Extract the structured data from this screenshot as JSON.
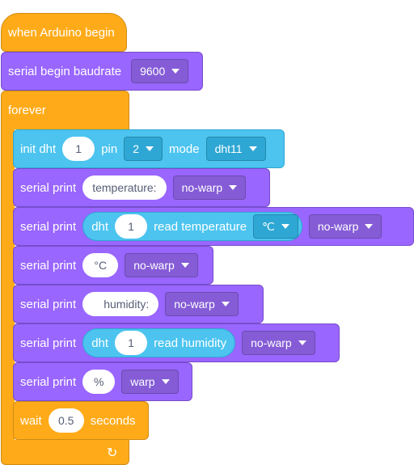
{
  "hat_label": "when Arduino begin",
  "serial_begin": {
    "label": "serial begin baudrate",
    "baud": "9600"
  },
  "forever_label": "forever",
  "init_dht": {
    "label": "init dht",
    "num": "1",
    "pin_label": "pin",
    "pin": "2",
    "mode_label": "mode",
    "mode": "dht11"
  },
  "print1": {
    "label": "serial print",
    "text": "temperature:",
    "warp": "no-warp"
  },
  "print2": {
    "label": "serial print",
    "dht_label": "dht",
    "dht_num": "1",
    "read_label": "read temperature",
    "unit": "℃",
    "warp": "no-warp"
  },
  "print3": {
    "label": "serial print",
    "text": "°C",
    "warp": "no-warp"
  },
  "print4": {
    "label": "serial print",
    "text": "humidity:",
    "warp": "no-warp"
  },
  "print5": {
    "label": "serial print",
    "dht_label": "dht",
    "dht_num": "1",
    "read_label": "read humidity",
    "warp": "no-warp"
  },
  "print6": {
    "label": "serial print",
    "text": "%",
    "warp": "warp"
  },
  "wait": {
    "label": "wait",
    "value": "0.5",
    "unit": "seconds"
  },
  "icons": {
    "loop": "loop-arrow-icon",
    "dropdown": "caret-down-icon"
  },
  "colors": {
    "events": "#ffab19",
    "purple": "#9966ff",
    "cyan": "#4cc4ef"
  }
}
